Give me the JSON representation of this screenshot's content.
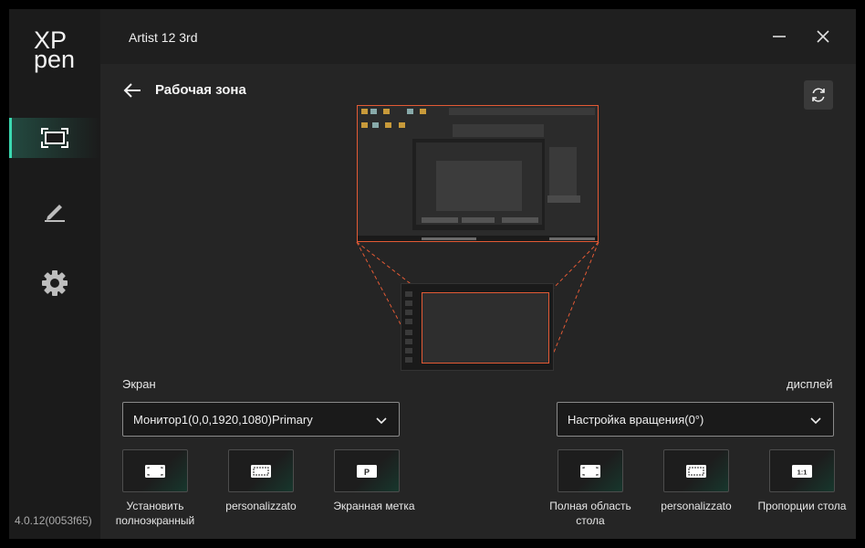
{
  "app": {
    "title": "Artist 12 3rd",
    "version": "4.0.12(0053f65)"
  },
  "logo": {
    "line1": "XP",
    "line2": "pen"
  },
  "sidebar": {
    "items": [
      {
        "name": "work-area",
        "icon": "fullscreen-icon",
        "active": true
      },
      {
        "name": "pen",
        "icon": "pen-icon",
        "active": false
      },
      {
        "name": "settings",
        "icon": "gear-icon",
        "active": false
      }
    ]
  },
  "page": {
    "title": "Рабочая зона"
  },
  "screen": {
    "label": "Экран",
    "selected": "Монитор1(0,0,1920,1080)Primary",
    "options": [
      {
        "label": "Установить полноэкранный",
        "icon": "fullscreen-icon"
      },
      {
        "label": "personalizzato",
        "icon": "custom-area-icon"
      },
      {
        "label": "Экранная метка",
        "icon": "screen-mark-icon",
        "glyph": "P"
      }
    ]
  },
  "display": {
    "label": "дисплей",
    "selected": "Настройка вращения(0°)",
    "options": [
      {
        "label": "Полная область стола",
        "icon": "full-area-icon"
      },
      {
        "label": "personalizzato",
        "icon": "custom-area-icon"
      },
      {
        "label": "Пропорции стола",
        "icon": "ratio-icon",
        "glyph": "1:1"
      }
    ]
  },
  "colors": {
    "accent": "#3ad8b0",
    "highlight": "#e35a35",
    "panel": "#252525"
  }
}
